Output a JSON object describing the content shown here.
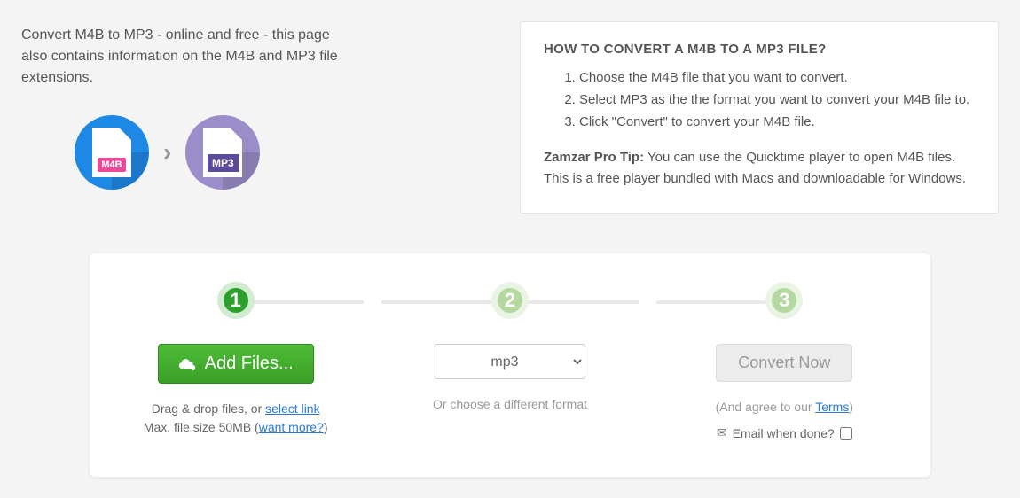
{
  "intro": {
    "text": "Convert M4B to MP3 - online and free - this page also contains information on the M4B and MP3 file extensions.",
    "from_label": "M4B",
    "to_label": "MP3",
    "arrow": "›"
  },
  "howto": {
    "title": "HOW TO CONVERT A M4B TO A MP3 FILE?",
    "steps": [
      "Choose the M4B file that you want to convert.",
      "Select MP3 as the the format you want to convert your M4B file to.",
      "Click \"Convert\" to convert your M4B file."
    ],
    "protip_label": "Zamzar Pro Tip:",
    "protip_text": " You can use the Quicktime player to open M4B files. This is a free player bundled with Macs and downloadable for Windows."
  },
  "converter": {
    "step_numbers": [
      "1",
      "2",
      "3"
    ],
    "add_button": "Add Files...",
    "drag_prefix": "Drag & drop files, or ",
    "select_link": "select link",
    "max_prefix": "Max. file size 50MB (",
    "want_more": "want more?",
    "max_suffix": ")",
    "format_selected": "mp3",
    "format_hint": "Or choose a different format",
    "convert_button": "Convert Now",
    "agree_prefix": "(And agree to our ",
    "terms_link": "Terms",
    "agree_suffix": ")",
    "email_label": "Email when done?"
  }
}
